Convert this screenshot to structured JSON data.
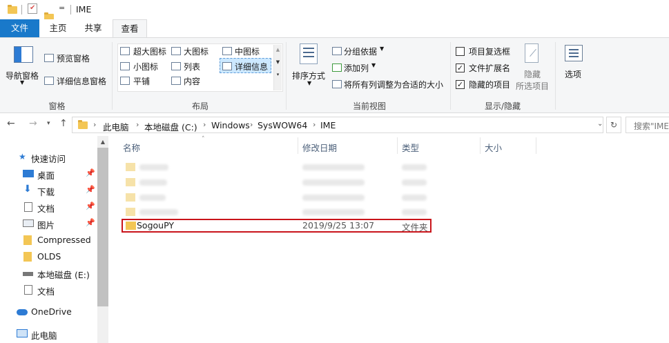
{
  "titlebar": {
    "title": "IME",
    "qa_dropdown": "="
  },
  "tabs": [
    {
      "label": "文件",
      "active": false
    },
    {
      "label": "主页",
      "active": false
    },
    {
      "label": "共享",
      "active": false
    },
    {
      "label": "查看",
      "active": true
    }
  ],
  "ribbon": {
    "panes": {
      "nav_pane": "导航窗格",
      "preview_pane": "预览窗格",
      "details_pane": "详细信息窗格",
      "label": "窗格"
    },
    "layout": {
      "extra_large_icons": "超大图标",
      "large_icons": "大图标",
      "medium_icons": "中图标",
      "small_icons": "小图标",
      "list": "列表",
      "details": "详细信息",
      "tiles": "平铺",
      "content": "内容",
      "label": "布局"
    },
    "current_view": {
      "sort_by": "排序方式",
      "group_by": "分组依据",
      "add_columns": "添加列",
      "size_all_columns": "将所有列调整为合适的大小",
      "label": "当前视图"
    },
    "show_hide": {
      "item_checkboxes": "项目复选框",
      "item_checkboxes_checked": false,
      "file_extensions": "文件扩展名",
      "file_extensions_checked": true,
      "hidden_items": "隐藏的项目",
      "hidden_items_checked": true,
      "hide_selected_line1": "隐藏",
      "hide_selected_line2": "所选项目",
      "label": "显示/隐藏"
    },
    "options": "选项"
  },
  "address": {
    "crumbs": [
      "此电脑",
      "本地磁盘 (C:)",
      "Windows",
      "SysWOW64",
      "IME"
    ],
    "search_placeholder": "搜索\"IME\""
  },
  "navpane": {
    "quick_access": "快速访问",
    "items": [
      {
        "label": "桌面",
        "pinned": true
      },
      {
        "label": "下载",
        "pinned": true
      },
      {
        "label": "文档",
        "pinned": true
      },
      {
        "label": "图片",
        "pinned": true
      },
      {
        "label": "Compressed",
        "pinned": false
      },
      {
        "label": "OLDS",
        "pinned": false
      },
      {
        "label": "本地磁盘 (E:)",
        "pinned": false
      },
      {
        "label": "文档",
        "pinned": false
      }
    ],
    "onedrive": "OneDrive",
    "this_pc": "此电脑"
  },
  "filelist": {
    "columns": [
      "名称",
      "修改日期",
      "类型",
      "大小"
    ],
    "selected_row": {
      "name": "SogouPY",
      "modified": "2019/9/25 13:07",
      "type": "文件夹",
      "size": ""
    }
  },
  "colors": {
    "accent": "#1979ca",
    "selection_outline": "#c9141a",
    "folder": "#f3c655"
  }
}
